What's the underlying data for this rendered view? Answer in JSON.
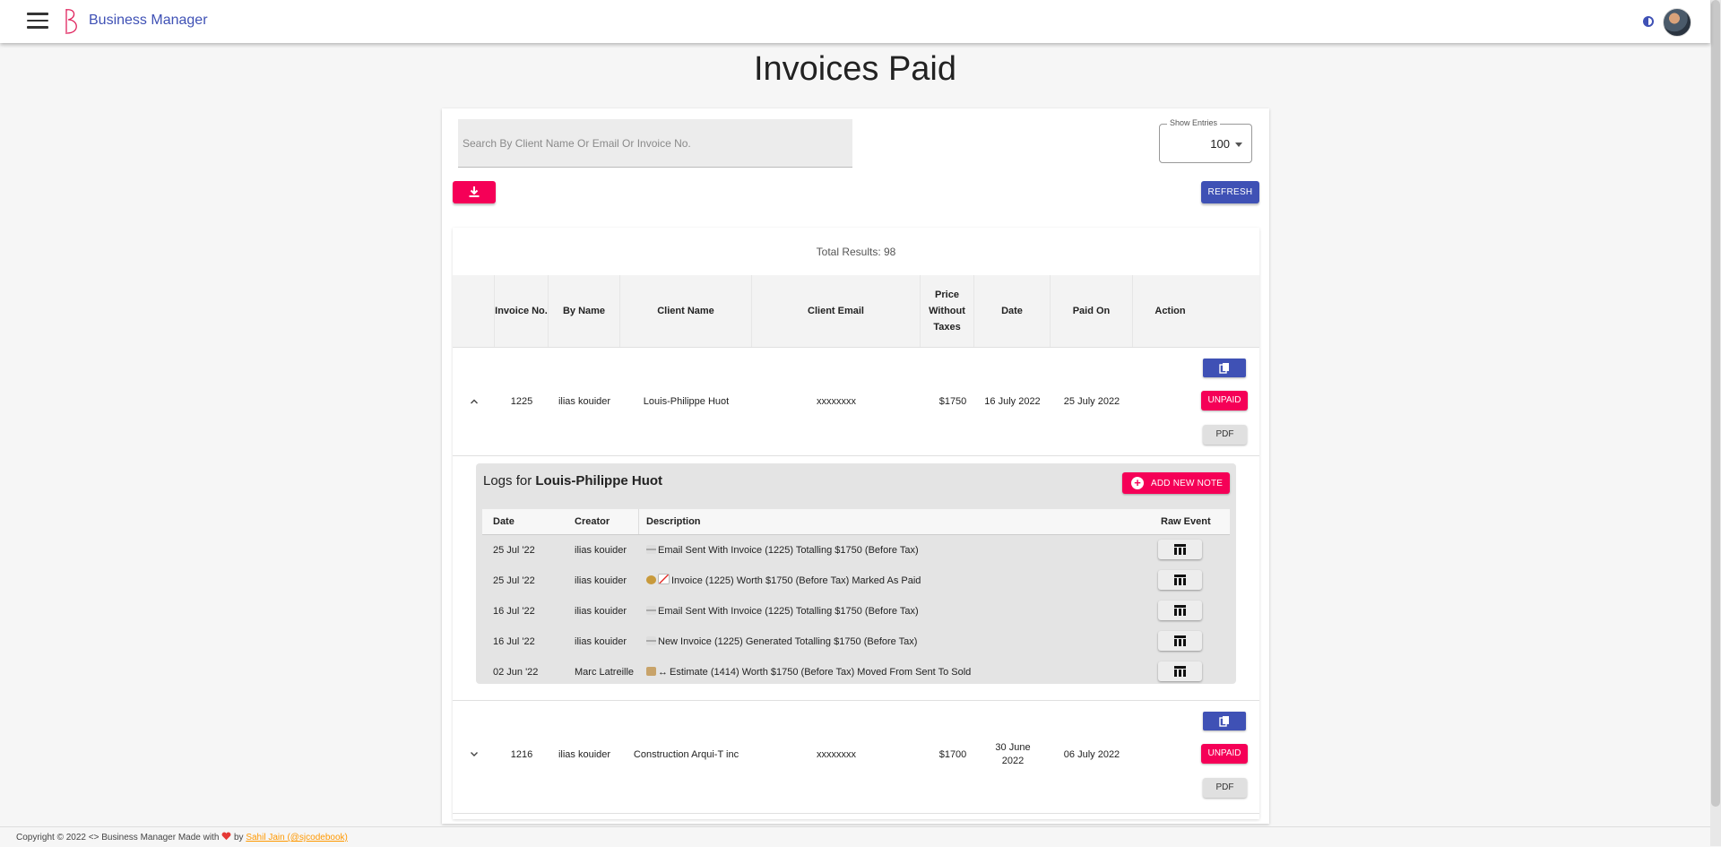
{
  "appbar": {
    "brand": "Business Manager"
  },
  "page": {
    "title": "Invoices Paid"
  },
  "search": {
    "placeholder": "Search By Client Name Or Email Or Invoice No."
  },
  "entries": {
    "label": "Show Entries",
    "value": "100"
  },
  "toolbar": {
    "refresh_label": "REFRESH",
    "download_icon": "download-icon"
  },
  "results": {
    "total_text": "Total Results: 98"
  },
  "table": {
    "headers": [
      "Invoice No.",
      "By Name",
      "Client Name",
      "Client Email",
      "Price Without Taxes",
      "Date",
      "Paid On",
      "Action"
    ],
    "rows": [
      {
        "invoice": "1225",
        "by": "ilias kouider",
        "client": "Louis-Philippe Huot",
        "email": "xxxxxxxx",
        "price": "$1750",
        "date": "16 July 2022",
        "paid": "25 July 2022",
        "unpaid_label": "UNPAID",
        "pdf_label": "PDF",
        "expanded": true
      },
      {
        "invoice": "1216",
        "by": "ilias kouider",
        "client": "Construction Arqui-T inc",
        "email": "xxxxxxxx",
        "price": "$1700",
        "date": "30 June 2022",
        "paid": "06 July 2022",
        "unpaid_label": "UNPAID",
        "pdf_label": "PDF",
        "expanded": false
      }
    ]
  },
  "logs": {
    "title_prefix": "Logs for",
    "client": "Louis-Philippe Huot",
    "add_note_label": "ADD NEW NOTE",
    "headers": [
      "Date",
      "Creator",
      "Description",
      "Raw Event"
    ],
    "rows": [
      {
        "date": "25 Jul '22",
        "creator": "ilias kouider",
        "icon": "email-icon",
        "description": "Email Sent With Invoice (1225) Totalling $1750 (Before Tax)"
      },
      {
        "date": "25 Jul '22",
        "creator": "ilias kouider",
        "icon": "money-bag-chart-icon",
        "description": "Invoice (1225) Worth $1750 (Before Tax) Marked As Paid"
      },
      {
        "date": "16 Jul '22",
        "creator": "ilias kouider",
        "icon": "email-icon",
        "description": "Email Sent With Invoice (1225) Totalling $1750 (Before Tax)"
      },
      {
        "date": "16 Jul '22",
        "creator": "ilias kouider",
        "icon": "email-icon",
        "description": "New Invoice (1225) Generated Totalling $1750 (Before Tax)"
      },
      {
        "date": "02 Jun '22",
        "creator": "Marc Latreille",
        "icon": "scroll-arrow-icon",
        "description": "Estimate (1414) Worth $1750 (Before Tax) Moved From Sent To Sold"
      }
    ]
  },
  "footer": {
    "copyright": "Copyright © 2022",
    "code_symbol": "<>",
    "made_with": "Business Manager Made with",
    "by": "by",
    "author_link": "Sahil Jain (@sjcodebook)"
  },
  "colors": {
    "primary": "#3f51b5",
    "secondary": "#f50057",
    "link": "#ff9800"
  }
}
